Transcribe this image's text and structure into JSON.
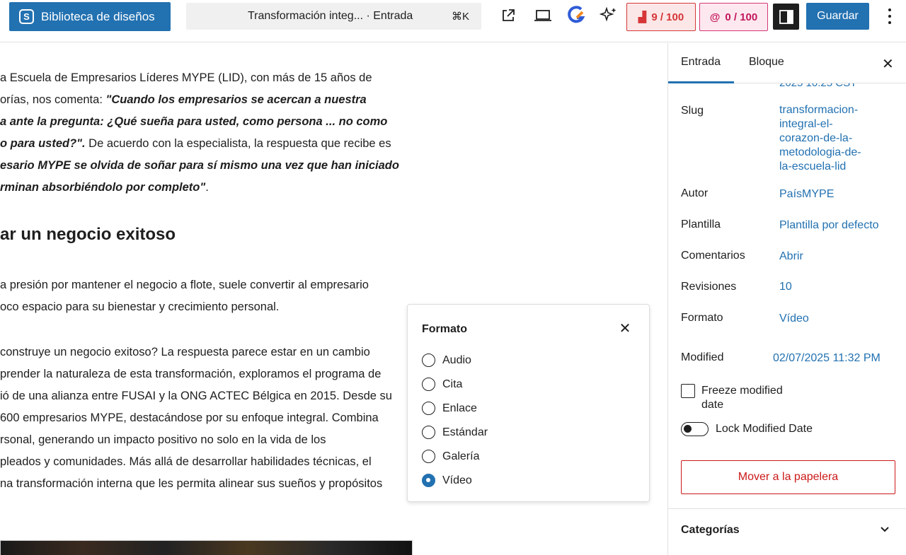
{
  "topbar": {
    "library_label": "Biblioteca de diseños",
    "doc_title": "Transformación integ...  · Entrada",
    "shortcut": "⌘K",
    "seo_score": "9 / 100",
    "readability_score": "0 / 100",
    "save_label": "Guardar"
  },
  "editor": {
    "lines": [
      "a Escuela de Empresarios Líderes MYPE (LID), con más de 15 años de",
      "orías, nos comenta: \"Cuando los empresarios se acercan a nuestra",
      "a ante la pregunta: ¿Qué sueña para usted, como persona ... no como",
      "o para usted?\". De acuerdo con la especialista, la respuesta que recibe es",
      "esario MYPE se olvida de soñar para sí mismo una vez que han iniciado",
      "rminan absorbiéndolo por completo\"."
    ],
    "heading": "ar un negocio exitoso",
    "para2": [
      "a presión por mantener el negocio a flote, suele convertir al empresario",
      "oco espacio para su bienestar y crecimiento personal."
    ],
    "para3": [
      " construye un negocio exitoso? La respuesta parece estar en un cambio",
      "prender la naturaleza de esta transformación, exploramos el programa de",
      "ió de una alianza entre FUSAI y la ONG ACTEC Bélgica en 2015. Desde su",
      "600 empresarios MYPE, destacándose por su enfoque integral. Combina",
      "rsonal, generando un impacto positivo no solo en la vida de los",
      "pleados y comunidades. Más allá de desarrollar habilidades técnicas, el",
      "na transformación interna que les permita alinear sus sueños y propósitos"
    ]
  },
  "format_popover": {
    "title": "Formato",
    "options": [
      "Audio",
      "Cita",
      "Enlace",
      "Estándar",
      "Galería",
      "Vídeo"
    ],
    "selected": "Vídeo"
  },
  "sidebar": {
    "tab_post": "Entrada",
    "tab_block": "Bloque",
    "cut_date": "2025 10:25 CST",
    "slug_label": "Slug",
    "slug_value": "transformacion-\nintegral-el-\ncorazon-de-la-\nmetodologia-de-\nla-escuela-lid",
    "author_label": "Autor",
    "author_value": "PaísMYPE",
    "template_label": "Plantilla",
    "template_value": "Plantilla por defecto",
    "comments_label": "Comentarios",
    "comments_value": "Abrir",
    "revisions_label": "Revisiones",
    "revisions_value": "10",
    "format_label": "Formato",
    "format_value": "Vídeo",
    "modified_label": "Modified",
    "modified_value": "02/07/2025 11:32 PM",
    "freeze_label": "Freeze modified\ndate",
    "lock_label": "Lock Modified Date",
    "trash_label": "Mover a la papelera",
    "categories_label": "Categorías"
  }
}
